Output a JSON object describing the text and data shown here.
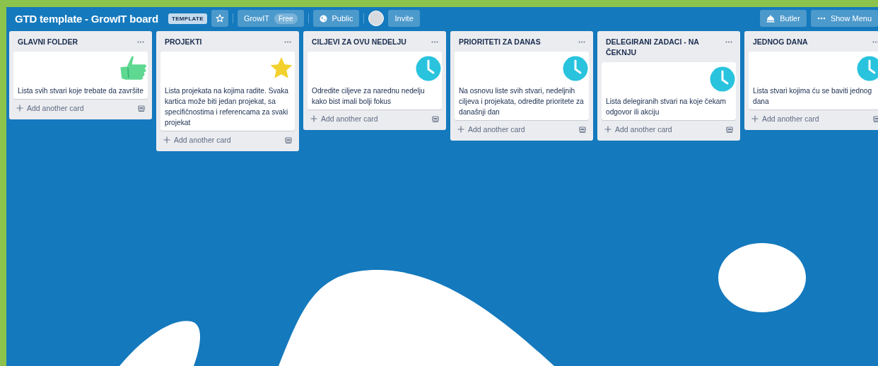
{
  "board": {
    "title": "GTD template - GrowIT board",
    "badge": "TEMPLATE",
    "starred": false,
    "team": {
      "label": "GrowIT",
      "tag": "Free"
    },
    "visibility": "Public",
    "invite": "Invite",
    "butler": "Butler",
    "menu": "Show Menu"
  },
  "lists": [
    {
      "title": "GLAVNI FOLDER",
      "cards": [
        {
          "text": "Lista svih stvari koje trebate da završite",
          "kind": "thumbs-up"
        }
      ],
      "add": "Add another card"
    },
    {
      "title": "PROJEKTI",
      "cards": [
        {
          "text": "Lista projekata na kojima radite. Svaka kartica može biti jedan projekat, sa specifičnostima i referencama za svaki projekat",
          "kind": "star"
        }
      ],
      "add": "Add another card"
    },
    {
      "title": "CILJEVI ZA OVU NEDELJU",
      "cards": [
        {
          "text": "Odredite ciljeve za narednu nedelju kako bist imali bolji fokus",
          "kind": "clock"
        }
      ],
      "add": "Add another card"
    },
    {
      "title": "PRIORITETI ZA DANAS",
      "cards": [
        {
          "text": "Na osnovu liste svih stvari, nedeljnih ciljeva i projekata, odredite prioritete za današnji dan",
          "kind": "clock"
        }
      ],
      "add": "Add another card"
    },
    {
      "title": "DELEGIRANI ZADACI - NA ČEKNJU",
      "cards": [
        {
          "text": "Lista delegiranih stvari na koje čekam odgovor ili akciju",
          "kind": "clock"
        }
      ],
      "add": "Add another card"
    },
    {
      "title": "JEDNOG DANA",
      "cards": [
        {
          "text": "Lista stvari kojima ću se baviti jednog dana",
          "kind": "clock"
        }
      ],
      "add": "Add another card"
    }
  ]
}
